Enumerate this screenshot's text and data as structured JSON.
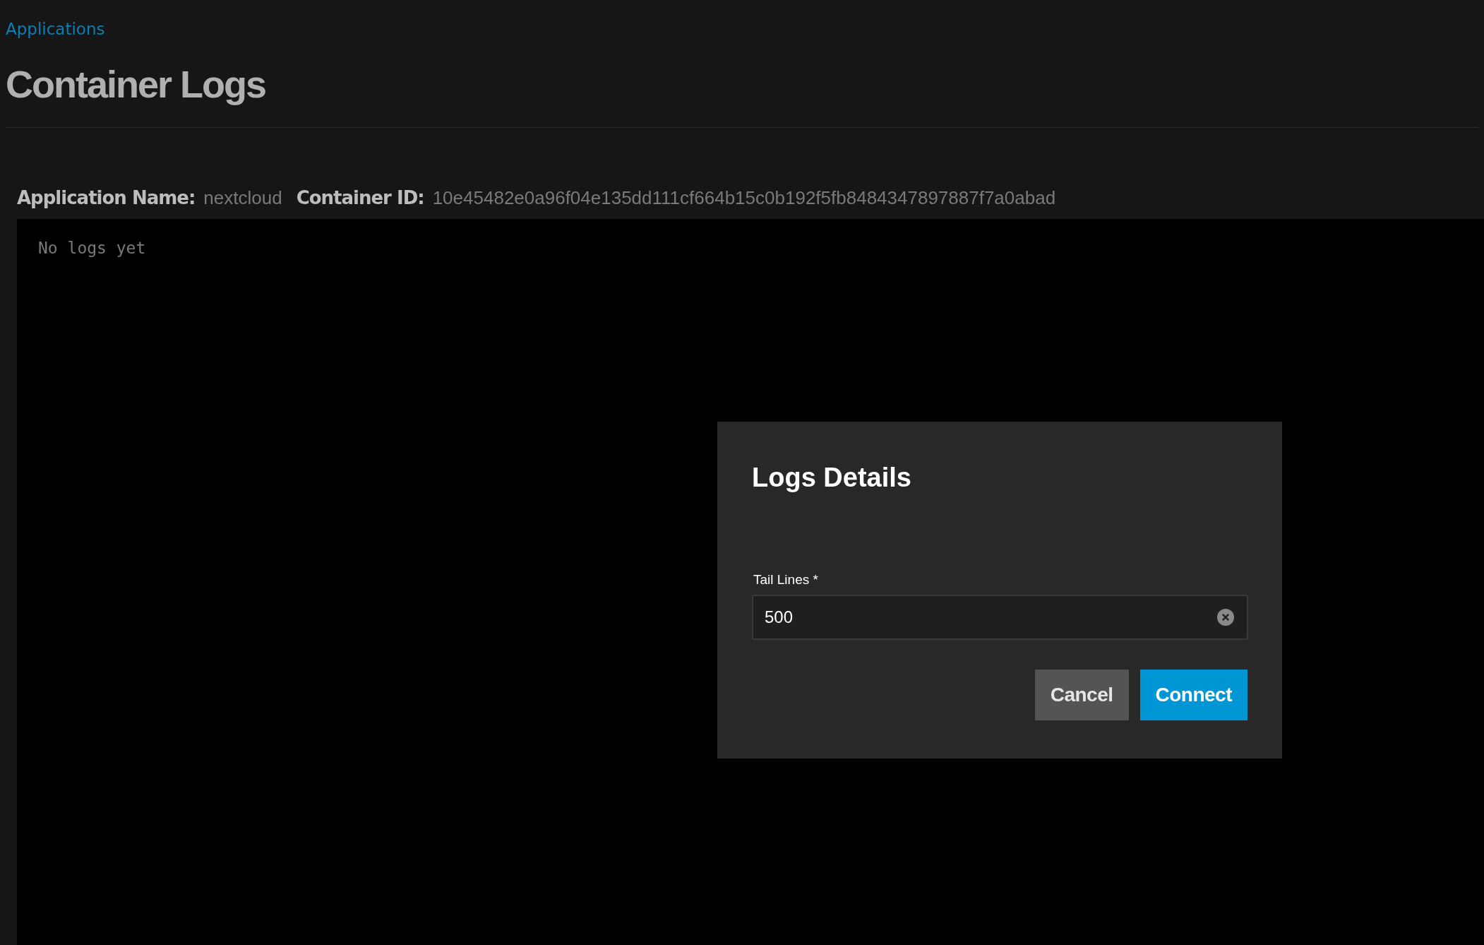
{
  "breadcrumb": "Applications",
  "page_title": "Container Logs",
  "info": [
    {
      "label": "Application Name:",
      "value": "nextcloud"
    },
    {
      "label": "Container ID:",
      "value": "10e45482e0a96f04e135dd111cf664b15c0b192f5fb8484347897887f7a0abad"
    }
  ],
  "log": {
    "message": "No logs yet"
  },
  "dialog": {
    "title": "Logs Details",
    "field": {
      "label": "Tail Lines *",
      "value": "500"
    },
    "buttons": [
      {
        "label": "Cancel",
        "kind": "secondary"
      },
      {
        "label": "Connect",
        "kind": "primary"
      }
    ]
  }
}
